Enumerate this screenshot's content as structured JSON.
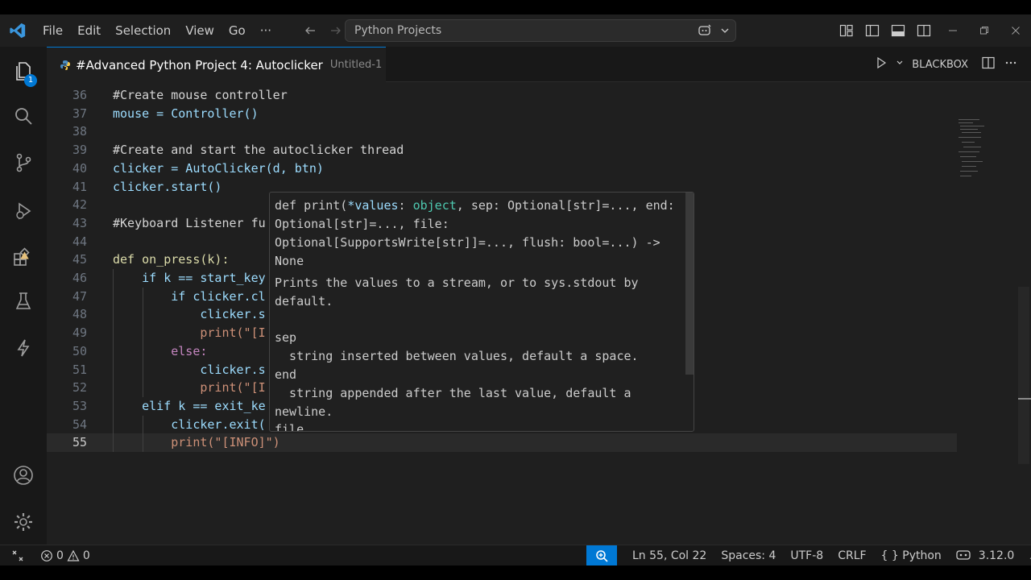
{
  "titlebar": {
    "menu": [
      "File",
      "Edit",
      "Selection",
      "View",
      "Go",
      "···"
    ],
    "search_text": "Python Projects"
  },
  "activitybar": {
    "explorer_badge": "1"
  },
  "tab": {
    "title": "#Advanced Python Project 4: Autoclicker",
    "subtitle": "Untitled-1",
    "blackbox_label": "BLACKBOX"
  },
  "code": {
    "lines": [
      {
        "n": "36",
        "text": "#Create mouse controller"
      },
      {
        "n": "37",
        "text": "mouse = Controller()"
      },
      {
        "n": "38",
        "text": ""
      },
      {
        "n": "39",
        "text": "#Create and start the autoclicker thread"
      },
      {
        "n": "40",
        "text": "clicker = AutoClicker(d, btn)"
      },
      {
        "n": "41",
        "text": "clicker.start()"
      },
      {
        "n": "42",
        "text": ""
      },
      {
        "n": "43",
        "text": "#Keyboard Listener fu"
      },
      {
        "n": "44",
        "text": ""
      },
      {
        "n": "45",
        "text": "def on_press(k):"
      },
      {
        "n": "46",
        "text": "    if k == start_key"
      },
      {
        "n": "47",
        "text": "        if clicker.cl"
      },
      {
        "n": "48",
        "text": "            clicker.s"
      },
      {
        "n": "49",
        "text": "            print(\"[I"
      },
      {
        "n": "50",
        "text": "        else:"
      },
      {
        "n": "51",
        "text": "            clicker.s"
      },
      {
        "n": "52",
        "text": "            print(\"[I"
      },
      {
        "n": "53",
        "text": "    elif k == exit_ke"
      },
      {
        "n": "54",
        "text": "        clicker.exit("
      },
      {
        "n": "55",
        "text": "        print(\"[INFO]\")"
      }
    ]
  },
  "hover": {
    "sig_def": "def print(",
    "sig_values": "*values",
    "sig_colon": ": ",
    "sig_object": "object",
    "sig_rest1": ", sep: Optional[str]=..., end:",
    "sig_line2": "Optional[str]=..., file:",
    "sig_line3": "Optional[SupportsWrite[str]]=..., flush: bool=...) ->",
    "sig_line4": "None",
    "doc1": "Prints the values to a stream, or to sys.stdout by",
    "doc2": "default.",
    "doc3": "",
    "doc4": "sep",
    "doc5": "  string inserted between values, default a space.",
    "doc6": "end",
    "doc7": "  string appended after the last value, default a",
    "doc8": "newline.",
    "doc9": "file"
  },
  "status": {
    "errors": "0",
    "warnings": "0",
    "position": "Ln 55, Col 22",
    "spaces": "Spaces: 4",
    "encoding": "UTF-8",
    "eol": "CRLF",
    "language": "Python",
    "version": "3.12.0"
  },
  "colors": {
    "accent": "#0078d4",
    "editor_bg": "#1f1f1f",
    "warning": "#e5c07b"
  }
}
